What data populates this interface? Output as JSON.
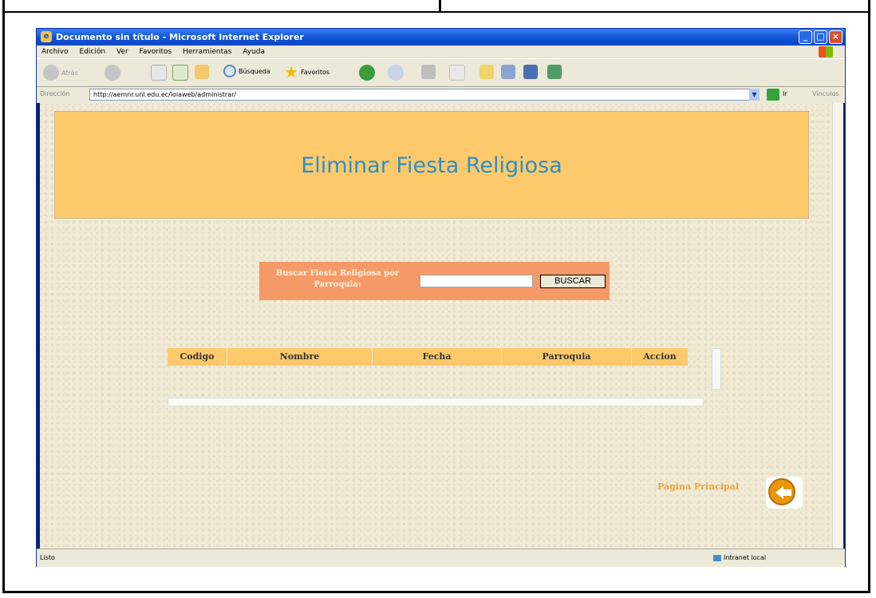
{
  "window": {
    "title": "Documento sin título - Microsoft Internet Explorer"
  },
  "menu": {
    "items": [
      "Archivo",
      "Edición",
      "Ver",
      "Favoritos",
      "Herramientas",
      "Ayuda"
    ]
  },
  "toolbar": {
    "back_label": "Atrás",
    "search_label": "Búsqueda",
    "favorites_label": "Favoritos"
  },
  "address": {
    "label": "Dirección",
    "url": "http://aemnr.unl.edu.ec/loiaweb/administrar/",
    "go_label": "Ir",
    "links_label": "Vínculos"
  },
  "page": {
    "header_title": "Eliminar Fiesta Religiosa",
    "search_label": "Buscar Fiesta Religiosa por Parroquia:",
    "search_value": "",
    "search_button": "BUSCAR",
    "table_headers": [
      "Codigo",
      "Nombre",
      "Fecha",
      "Parroquia",
      "Accion"
    ],
    "home_link": "Página Principal"
  },
  "status": {
    "left": "Listo",
    "right": "Intranet local"
  },
  "colors": {
    "header_bg": "#fdc96a",
    "header_text": "#2e8fc7",
    "search_bg": "#f59a67",
    "home_link": "#f0a33c"
  }
}
